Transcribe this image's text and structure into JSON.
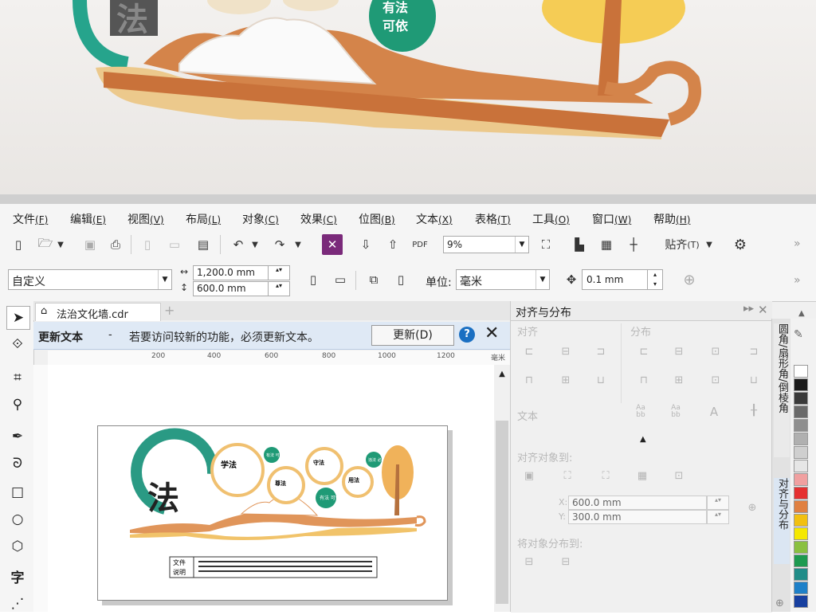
{
  "render": {
    "big_char": "法",
    "badge_text_1": "有法",
    "badge_text_2": "可依"
  },
  "menu": [
    {
      "label": "文件",
      "key": "F"
    },
    {
      "label": "编辑",
      "key": "E"
    },
    {
      "label": "视图",
      "key": "V"
    },
    {
      "label": "布局",
      "key": "L"
    },
    {
      "label": "对象",
      "key": "C"
    },
    {
      "label": "效果",
      "key": "C"
    },
    {
      "label": "位图",
      "key": "B"
    },
    {
      "label": "文本",
      "key": "X"
    },
    {
      "label": "表格",
      "key": "T"
    },
    {
      "label": "工具",
      "key": "O"
    },
    {
      "label": "窗口",
      "key": "W"
    },
    {
      "label": "帮助",
      "key": "H"
    }
  ],
  "toolbar1": {
    "zoom": "9%",
    "snap_label": "贴齐",
    "snap_key": "T"
  },
  "toolbar2": {
    "page_size": "自定义",
    "width": "1,200.0 mm",
    "height": "600.0 mm",
    "unit_label": "单位:",
    "unit_value": "毫米",
    "nudge": "0.1 mm"
  },
  "document": {
    "tab_name": "法治文化墙.cdr",
    "add_tab": "+"
  },
  "notification": {
    "title": "更新文本",
    "dash": "-",
    "message": "若要访问较新的功能，必须更新文本。",
    "button": "更新(D)",
    "help": "?"
  },
  "ruler": {
    "ticks": [
      "200",
      "400",
      "600",
      "800",
      "1000",
      "1200"
    ],
    "unit": "毫米"
  },
  "artwork": {
    "big_char": "法",
    "circle_1": "学法",
    "circle_2": "尊法",
    "circle_3": "守法",
    "circle_4": "用法",
    "badge_1": "有法\n可依",
    "badge_2": "违法\n必究",
    "badge_3": "有法\n可依",
    "note_label_1": "文件",
    "note_label_2": "说明"
  },
  "panel": {
    "title": "对齐与分布",
    "section_align": "对齐",
    "section_distribute": "分布",
    "section_text": "文本",
    "text_aa_1": "Aa\nbb",
    "text_aa_2": "Aa\nbb",
    "text_aa_3": "A",
    "align_to": "对齐对象到:",
    "x_label": "X:",
    "x_value": "600.0 mm",
    "y_label": "Y:",
    "y_value": "300.0 mm",
    "distribute_to": "将对象分布到:"
  },
  "side_tabs": {
    "tab1": "圆角/扇形角/倒棱角",
    "tab2": "对齐与分布"
  },
  "palette": [
    "#ffffff",
    "#1a1a1a",
    "#3a3a3a",
    "#6a6a6a",
    "#8e8e8e",
    "#b0b0b0",
    "#cfcfcf",
    "#e6e6e6",
    "#f0a0a0",
    "#e53030",
    "#e08040",
    "#f2c010",
    "#f5e800",
    "#8ac040",
    "#1e9a50",
    "#208c88",
    "#1e80c8",
    "#1840a0"
  ]
}
